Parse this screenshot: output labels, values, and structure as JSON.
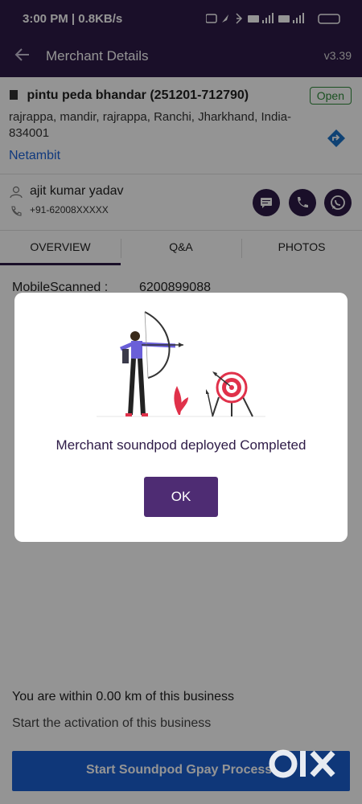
{
  "status_bar": {
    "time": "3:00 PM | 0.8KB/s",
    "battery": "4"
  },
  "app_bar": {
    "title": "Merchant Details",
    "version": "v3.39",
    "back_icon": "back-arrow-icon"
  },
  "merchant": {
    "name": "pintu peda bhandar (251201-712790)",
    "status": "Open",
    "address": "rajrappa, mandir, rajrappa, Ranchi, Jharkhand, India- 834001",
    "link": "Netambit"
  },
  "contact": {
    "name": "ajit kumar yadav",
    "phone": "+91-62008XXXXX"
  },
  "tabs": [
    {
      "label": "OVERVIEW"
    },
    {
      "label": "Q&A"
    },
    {
      "label": "PHOTOS"
    }
  ],
  "overview": {
    "mobile_label": "MobileScanned :",
    "mobile_value": "6200899088"
  },
  "footer": {
    "distance_text": "You are within 0.00 km of this business",
    "activation_text": "Start the activation of this business",
    "start_button": "Start Soundpod Gpay Process"
  },
  "dialog": {
    "message": "Merchant  soundpod deployed Completed",
    "ok_label": "OK"
  },
  "colors": {
    "primary": "#2e1b47",
    "accent_blue": "#1b5fd1",
    "open_green": "#2e8b3a",
    "dialog_button": "#4e2c73",
    "target_red": "#e0314a"
  }
}
